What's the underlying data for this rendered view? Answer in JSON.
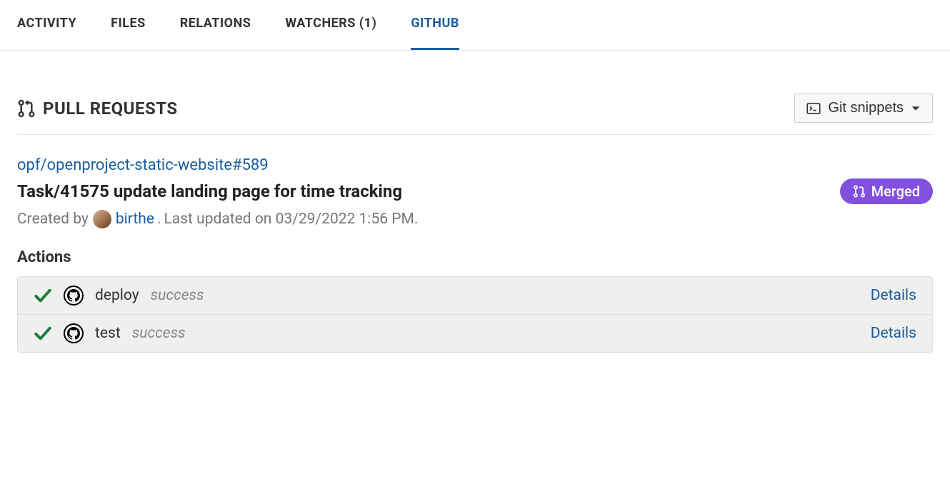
{
  "tabs": {
    "activity": "ACTIVITY",
    "files": "FILES",
    "relations": "RELATIONS",
    "watchers": "WATCHERS (1)",
    "github": "GITHUB"
  },
  "section": {
    "title": "PULL REQUESTS",
    "git_snippets_label": "Git snippets"
  },
  "pr": {
    "link": "opf/openproject-static-website#589",
    "title": "Task/41575 update landing page for time tracking",
    "status_label": "Merged",
    "created_by_prefix": "Created by",
    "author": "birthe",
    "author_suffix": ".",
    "last_updated": "Last updated on 03/29/2022 1:56 PM."
  },
  "actions": {
    "heading": "Actions",
    "details_label": "Details",
    "rows": [
      {
        "name": "deploy",
        "status": "success"
      },
      {
        "name": "test",
        "status": "success"
      }
    ]
  }
}
